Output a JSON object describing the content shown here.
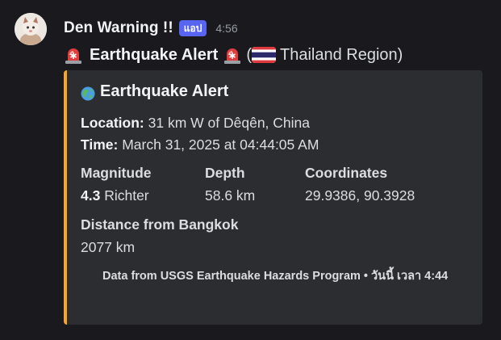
{
  "message": {
    "username": "Den Warning !!",
    "app_badge": "แอป",
    "timestamp": "4:56",
    "content": {
      "title": "Earthquake Alert",
      "region_open": "(",
      "region_text": "Thailand Region)",
      "emojis": [
        "rotating-light-icon",
        "flag-thailand-icon"
      ]
    }
  },
  "embed": {
    "accent_color": "#f5a623",
    "title": "Earthquake Alert",
    "title_icon": "globe-icon",
    "location_label": "Location:",
    "location_value": "31 km W of Dêqên, China",
    "time_label": "Time:",
    "time_value": "March 31, 2025 at 04:44:05 AM",
    "fields": {
      "magnitude": {
        "name": "Magnitude",
        "value_bold": "4.3",
        "value_rest": "Richter"
      },
      "depth": {
        "name": "Depth",
        "value": "58.6 km"
      },
      "coordinates": {
        "name": "Coordinates",
        "value": "29.9386, 90.3928"
      },
      "distance": {
        "name": "Distance from Bangkok",
        "value": "2077 km"
      }
    },
    "footer": "Data from USGS Earthquake Hazards Program • วันนี้ เวลา 4:44"
  }
}
